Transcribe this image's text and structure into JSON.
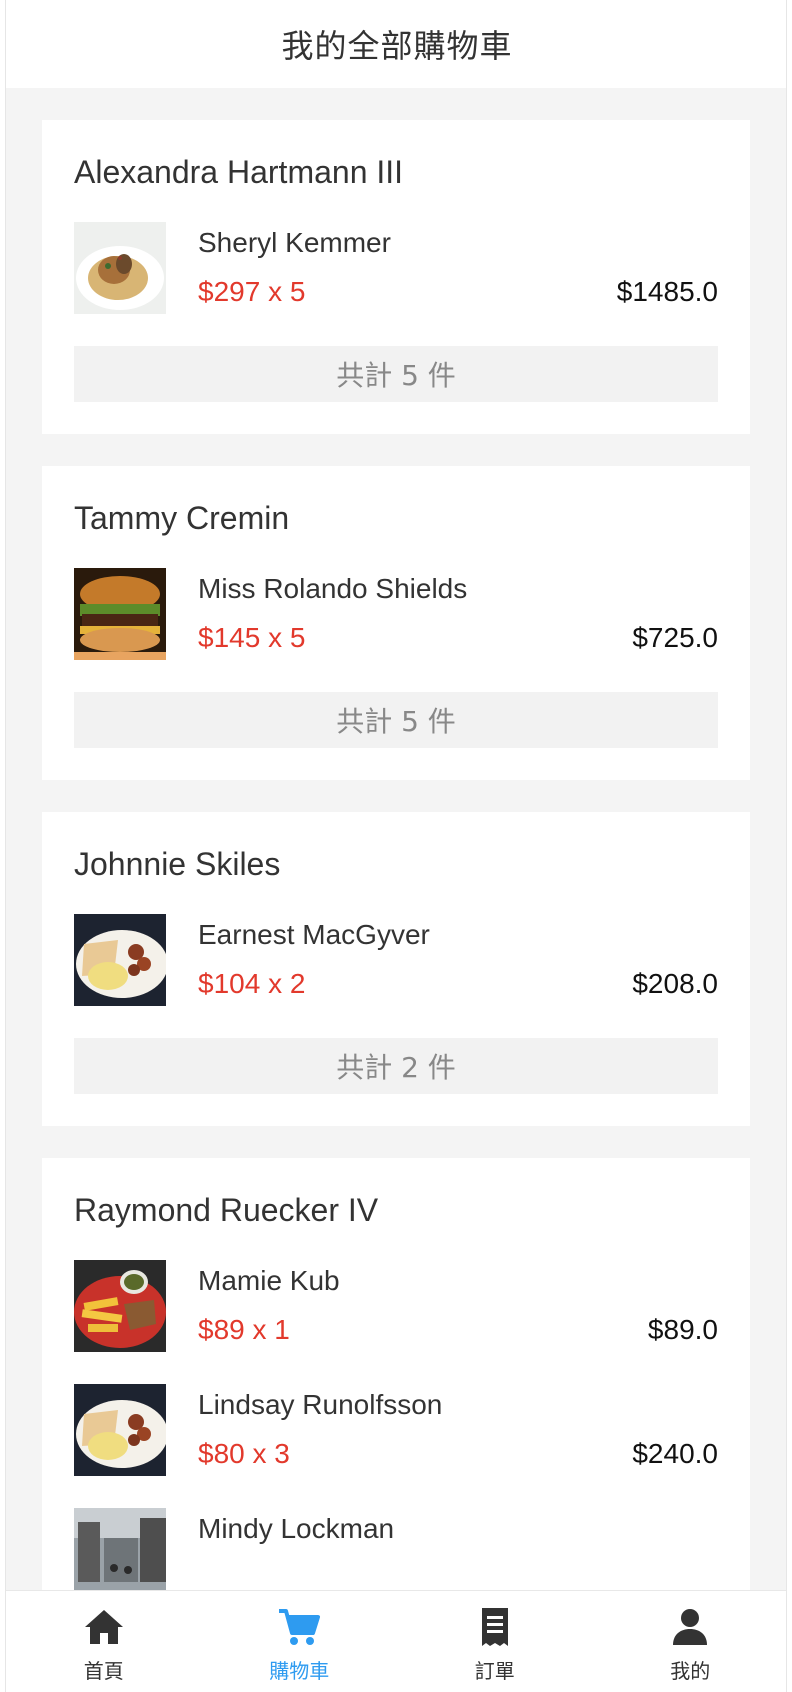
{
  "header": {
    "title": "我的全部購物車"
  },
  "carts": [
    {
      "shop": "Alexandra Hartmann III",
      "items": [
        {
          "name": "Sheryl Kemmer",
          "price_qty": "$297 x 5",
          "subtotal": "$1485.0",
          "thumb": "pasta-dish-photo"
        }
      ],
      "total": "共計 5 件"
    },
    {
      "shop": "Tammy Cremin",
      "items": [
        {
          "name": "Miss Rolando Shields",
          "price_qty": "$145 x 5",
          "subtotal": "$725.0",
          "thumb": "burger-photo"
        }
      ],
      "total": "共計 5 件"
    },
    {
      "shop": "Johnnie Skiles",
      "items": [
        {
          "name": "Earnest MacGyver",
          "price_qty": "$104 x 2",
          "subtotal": "$208.0",
          "thumb": "breakfast-plate-photo"
        }
      ],
      "total": "共計 2 件"
    },
    {
      "shop": "Raymond Ruecker IV",
      "items": [
        {
          "name": "Mamie Kub",
          "price_qty": "$89 x 1",
          "subtotal": "$89.0",
          "thumb": "fries-plate-photo"
        },
        {
          "name": "Lindsay Runolfsson",
          "price_qty": "$80 x 3",
          "subtotal": "$240.0",
          "thumb": "breakfast-plate-photo"
        },
        {
          "name": "Mindy Lockman",
          "price_qty": "",
          "subtotal": "",
          "thumb": "street-photo"
        }
      ],
      "total": ""
    }
  ],
  "tabbar": [
    {
      "label": "首頁",
      "icon": "home-icon",
      "active": false
    },
    {
      "label": "購物車",
      "icon": "cart-icon",
      "active": true
    },
    {
      "label": "訂單",
      "icon": "receipt-icon",
      "active": false
    },
    {
      "label": "我的",
      "icon": "user-icon",
      "active": false
    }
  ],
  "colors": {
    "accent": "#2e9bf0",
    "price": "#e2392c",
    "background": "#f4f4f4"
  }
}
